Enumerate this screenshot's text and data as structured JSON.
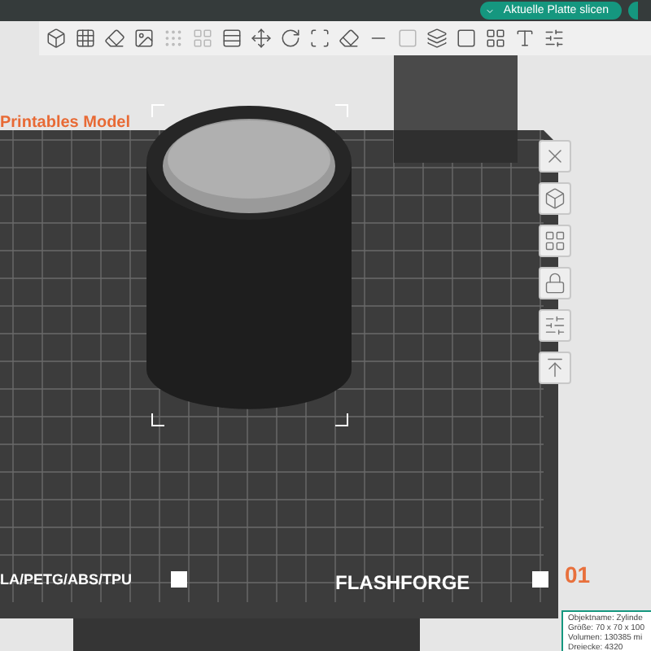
{
  "top_bar": {
    "slice_button": "Aktuelle Platte slicen"
  },
  "plate": {
    "model_label": "Printables Model",
    "filament_label": "LA/PETG/ABS/TPU",
    "brand": "FLASHFORGE",
    "plate_number": "01"
  },
  "object_info": {
    "lines": [
      "Objektname: Zylinde",
      "Größe: 70 x 70 x 100",
      "Volumen: 130385 mi",
      "Dreiecke: 4320"
    ]
  }
}
